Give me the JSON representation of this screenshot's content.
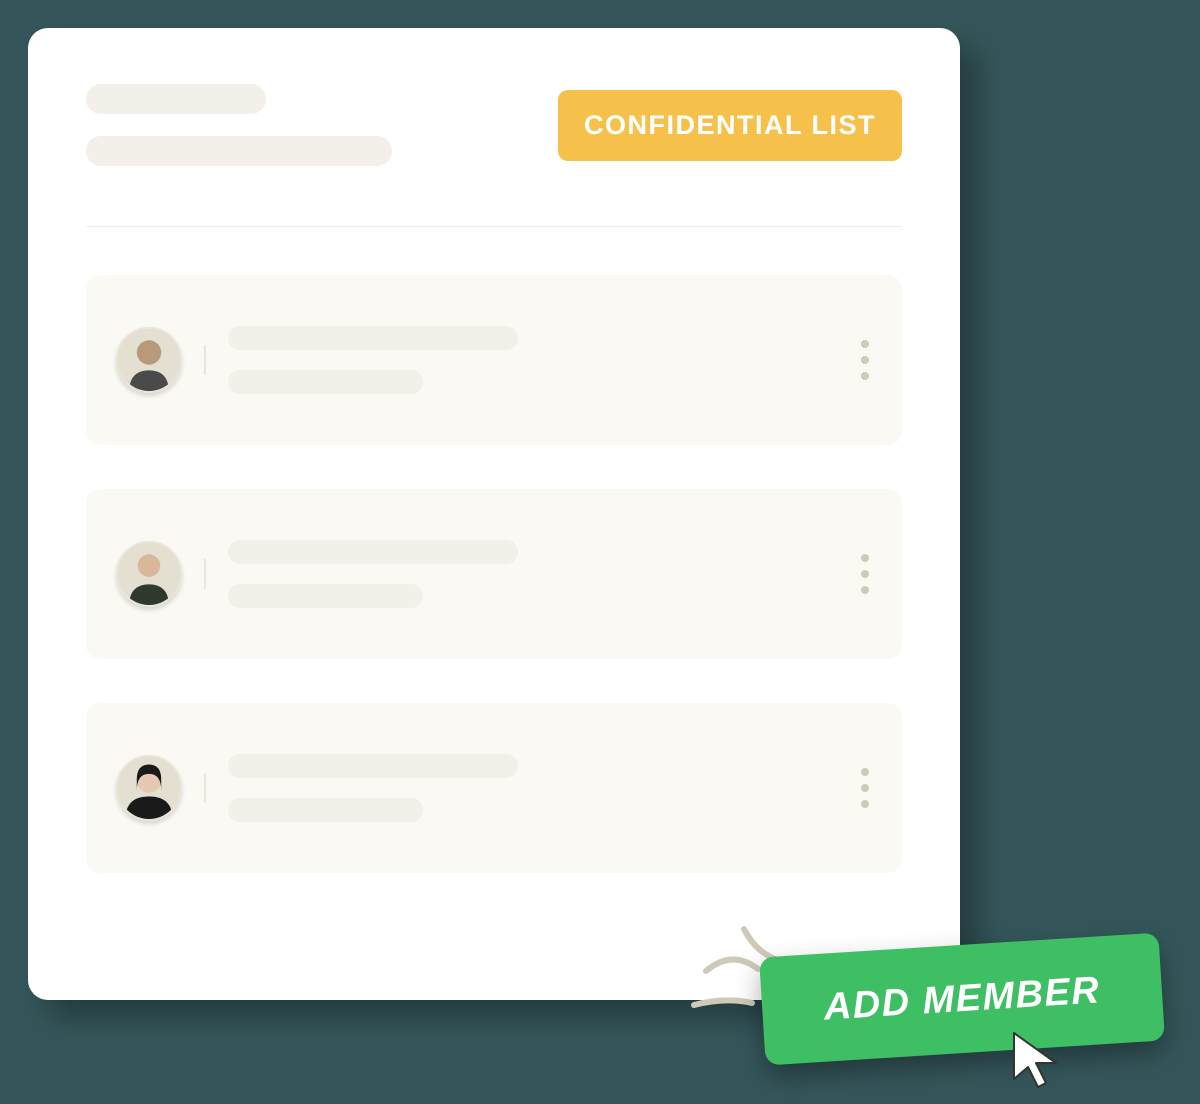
{
  "header": {
    "badge_label": "CONFIDENTIAL LIST"
  },
  "add_member_button_label": "ADD MEMBER"
}
